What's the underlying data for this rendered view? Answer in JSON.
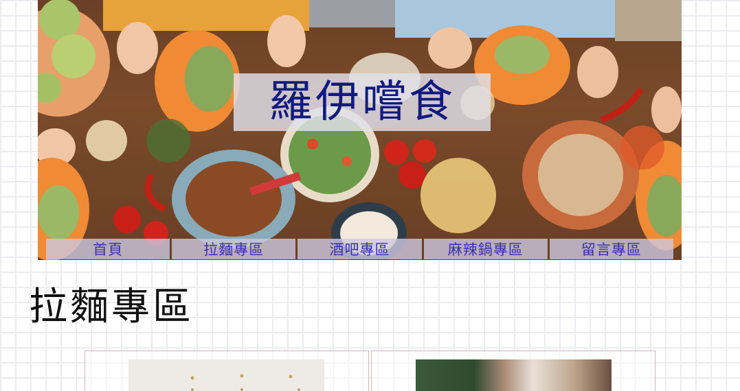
{
  "site": {
    "title": "羅伊嚐食"
  },
  "nav": {
    "items": [
      {
        "label": "首頁"
      },
      {
        "label": "拉麵專區"
      },
      {
        "label": "酒吧專區"
      },
      {
        "label": "麻辣鍋專區"
      },
      {
        "label": "留言專區"
      }
    ]
  },
  "section": {
    "title": "拉麵專區"
  },
  "cards": [
    {
      "image": "ramen-shop-interior-photo"
    },
    {
      "image": "street-storefront-photo"
    }
  ],
  "colors": {
    "title_text": "#101a80",
    "nav_text": "#3a2fb0",
    "nav_bg": "#cdc8e1",
    "table_wood": "#6b4026"
  }
}
